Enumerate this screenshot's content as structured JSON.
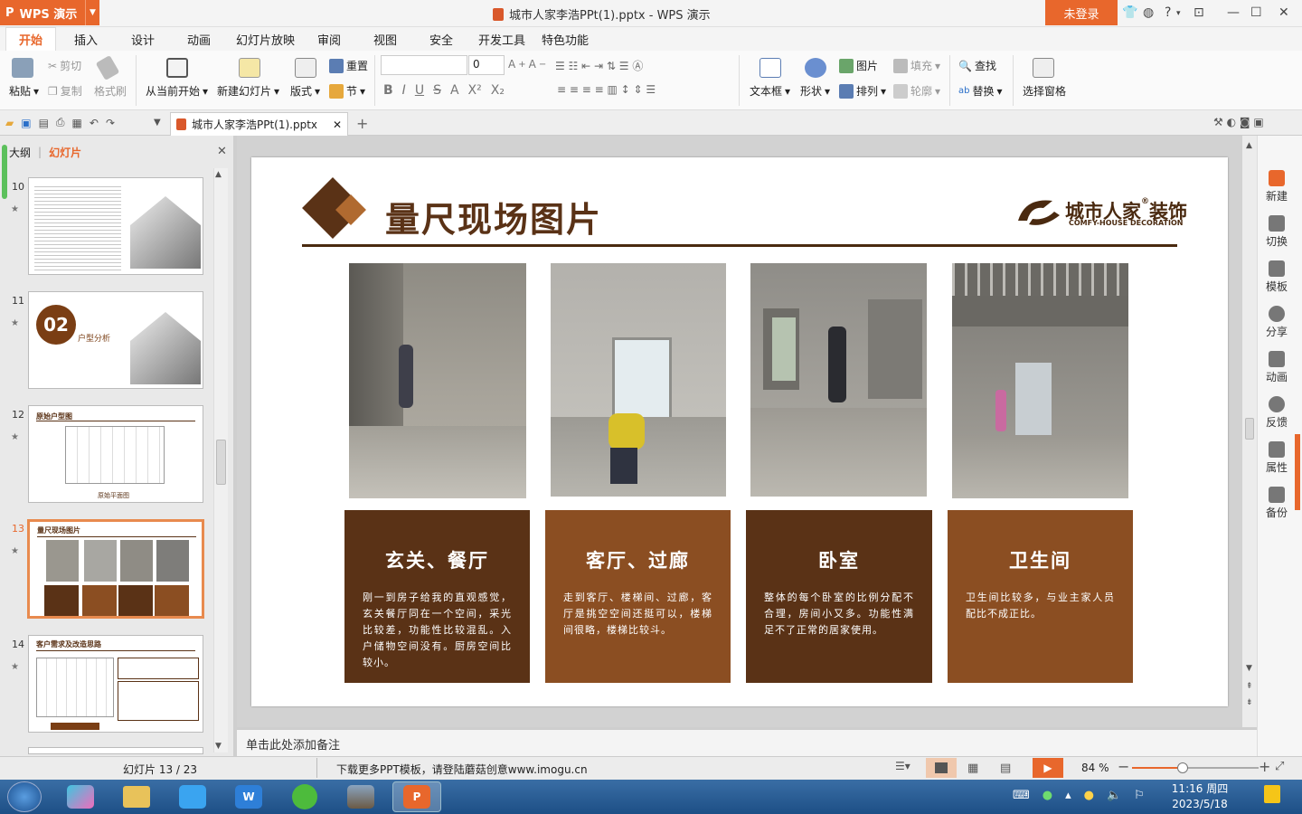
{
  "window": {
    "app_label": "WPS 演示",
    "title": "城市人家李浩PPt(1).pptx - WPS 演示",
    "login": "未登录"
  },
  "menu": [
    "开始",
    "插入",
    "设计",
    "动画",
    "幻灯片放映",
    "审阅",
    "视图",
    "安全",
    "开发工具",
    "特色功能"
  ],
  "ribbon": {
    "paste": "粘贴",
    "cut": "剪切",
    "copy": "复制",
    "format_painter": "格式刷",
    "from_current": "从当前开始",
    "new_slide": "新建幻灯片",
    "layout": "版式",
    "reset": "重置",
    "section": "节",
    "font_size": "0",
    "textbox": "文本框",
    "shape": "形状",
    "picture": "图片",
    "arrange": "排列",
    "fill": "填充",
    "outline": "轮廓",
    "find": "查找",
    "replace": "替换",
    "select_pane": "选择窗格"
  },
  "doc_tab": "城市人家李浩PPt(1).pptx",
  "panel": {
    "outline_tab": "大纲",
    "slides_tab": "幻灯片",
    "thumbnails": [
      {
        "num": "10"
      },
      {
        "num": "11",
        "badge": "02",
        "caption": "户型分析"
      },
      {
        "num": "12",
        "title": "原始户型图",
        "caption": "原始平面图"
      },
      {
        "num": "13",
        "title": "量尺现场图片"
      },
      {
        "num": "14",
        "title": "客户需求及改造思路"
      }
    ]
  },
  "slide": {
    "title": "量尺现场图片",
    "logo_cn": "城市人家",
    "logo_cn2": "装饰",
    "logo_en": "COMFY-HOUSE DECORATION",
    "boxes": [
      {
        "heading": "玄关、餐厅",
        "text": "刚一到房子给我的直观感觉，玄关餐厅同在一个空间，采光比较差，功能性比较混乱。入户储物空间没有。厨房空间比较小。",
        "color": "#5a3216"
      },
      {
        "heading": "客厅、过廊",
        "text": "走到客厅、楼梯间、过廊，客厅是挑空空间还挺可以，楼梯间很略，楼梯比较斗。",
        "color": "#8b4e22"
      },
      {
        "heading": "卧室",
        "text": "整体的每个卧室的比例分配不合理，房间小又多。功能性满足不了正常的居家使用。",
        "color": "#5a3216"
      },
      {
        "heading": "卫生间",
        "text": "卫生间比较多，与业主家人员配比不成正比。",
        "color": "#8b4e22"
      }
    ]
  },
  "notes_placeholder": "单击此处添加备注",
  "side": [
    "新建",
    "切换",
    "模板",
    "分享",
    "动画",
    "反馈",
    "属性",
    "备份"
  ],
  "status": {
    "slide_counter": "幻灯片 13 / 23",
    "ad": "下载更多PPT模板，请登陆蘑菇创意www.imogu.cn",
    "zoom": "84 %"
  },
  "clock": {
    "time": "11:16 周四",
    "date": "2023/5/18"
  },
  "colors": {
    "accent": "#e8672c",
    "dark_brown": "#5a3216",
    "mid_brown": "#8b4e22"
  }
}
